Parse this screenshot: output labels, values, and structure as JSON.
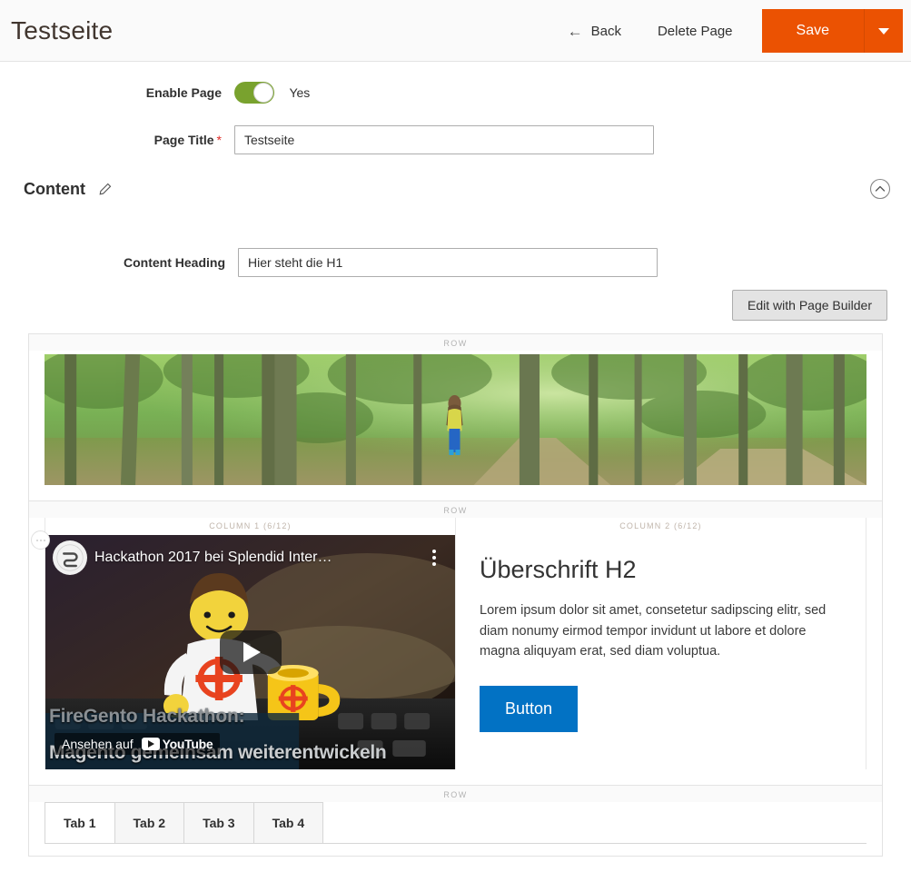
{
  "header": {
    "title": "Testseite",
    "back_label": "Back",
    "delete_label": "Delete Page",
    "save_label": "Save",
    "back_icon": "arrow-left-icon",
    "save_caret_icon": "caret-down-icon",
    "save_color": "#eb5202"
  },
  "form": {
    "enable_page": {
      "label": "Enable Page",
      "value": "Yes",
      "on": true,
      "toggle_color": "#79a22e"
    },
    "page_title": {
      "label": "Page Title",
      "required_marker": "*",
      "value": "Testseite",
      "placeholder": ""
    }
  },
  "content_section": {
    "title": "Content",
    "edit_icon": "pencil-icon",
    "collapse_icon": "chevron-up-circle-icon",
    "content_heading": {
      "label": "Content Heading",
      "value": "Hier steht die H1",
      "placeholder": ""
    },
    "page_builder_button": "Edit with Page Builder"
  },
  "stage": {
    "row1": {
      "label": "ROW",
      "image_alt": "forest-path-photo"
    },
    "row2": {
      "label": "ROW",
      "column1": {
        "label": "COLUMN 1 (6/12)",
        "drag_handle_icon": "drag-handle-icon",
        "video": {
          "title": "Hackathon 2017 bei Splendid Inter…",
          "channel_avatar_icon": "channel-avatar-icon",
          "kebab_icon": "more-options-icon",
          "play_icon": "play-button-icon",
          "watch_label": "Ansehen auf",
          "provider": "YouTube",
          "thumb_line1": "FireGento Hackathon:",
          "thumb_line2": "Magento gemeinsam weiterentwickeln"
        }
      },
      "column2": {
        "label": "COLUMN 2 (6/12)",
        "heading": "Überschrift H2",
        "paragraph": "Lorem ipsum dolor sit amet, consetetur sadipscing elitr, sed diam nonumy eirmod tempor invidunt ut labore et dolore magna aliquyam erat, sed diam voluptua.",
        "button_label": "Button",
        "button_color": "#0272c4"
      }
    },
    "row3": {
      "label": "ROW",
      "tabs": [
        {
          "label": "Tab 1",
          "active": true
        },
        {
          "label": "Tab 2",
          "active": false
        },
        {
          "label": "Tab 3",
          "active": false
        },
        {
          "label": "Tab 4",
          "active": false
        }
      ]
    }
  }
}
